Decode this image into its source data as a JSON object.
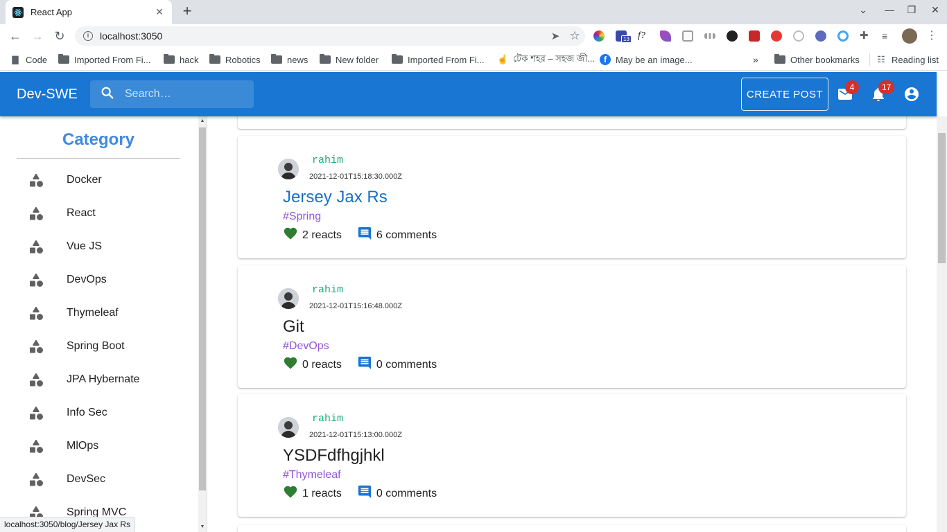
{
  "browser": {
    "tab_title": "React App",
    "url": "localhost:3050",
    "bookmarks": [
      {
        "label": "Code",
        "icon": "page-icon"
      },
      {
        "label": "Imported From Fi...",
        "icon": "folder-icon"
      },
      {
        "label": "hack",
        "icon": "folder-icon"
      },
      {
        "label": "Robotics",
        "icon": "folder-icon"
      },
      {
        "label": "news",
        "icon": "folder-icon"
      },
      {
        "label": "New folder",
        "icon": "folder-icon"
      },
      {
        "label": "Imported From Fi...",
        "icon": "folder-icon"
      },
      {
        "label": "টেক শহর – সহজ জী...",
        "icon": "hand-icon"
      },
      {
        "label": "May be an image...",
        "icon": "facebook-icon"
      }
    ],
    "other_bookmarks": "Other bookmarks",
    "reading_list": "Reading list",
    "extension_badge": "13",
    "status_url": "localhost:3050/blog/Jersey Jax Rs"
  },
  "app": {
    "brand": "Dev-SWE",
    "search_placeholder": "Search…",
    "create_post": "CREATE POST",
    "mail_count": "4",
    "notification_count": "17",
    "colors": {
      "primary": "#1976d2",
      "badge": "#d32f2f",
      "category_title": "#3f8ae0",
      "author": "#1ea97c",
      "tag": "#9256d6",
      "link": "#1a6fc4",
      "heart": "#2e7d32",
      "comment": "#1976d2"
    }
  },
  "sidebar": {
    "title": "Category",
    "items": [
      "Docker",
      "React",
      "Vue JS",
      "DevOps",
      "Thymeleaf",
      "Spring Boot",
      "JPA Hybernate",
      "Info Sec",
      "MlOps",
      "DevSec",
      "Spring MVC"
    ]
  },
  "posts": [
    {
      "author": "rahim",
      "date": "2021-12-01T15:18:30.000Z",
      "title": "Jersey Jax Rs",
      "tag": "#Spring",
      "reacts": "2 reacts",
      "comments": "6 comments"
    },
    {
      "author": "rahim",
      "date": "2021-12-01T15:16:48.000Z",
      "title": "Git",
      "tag": "#DevOps",
      "reacts": "0 reacts",
      "comments": "0 comments"
    },
    {
      "author": "rahim",
      "date": "2021-12-01T15:13:00.000Z",
      "title": "YSDFdfhgjhkl",
      "tag": "#Thymeleaf",
      "reacts": "1 reacts",
      "comments": "0 comments"
    }
  ]
}
